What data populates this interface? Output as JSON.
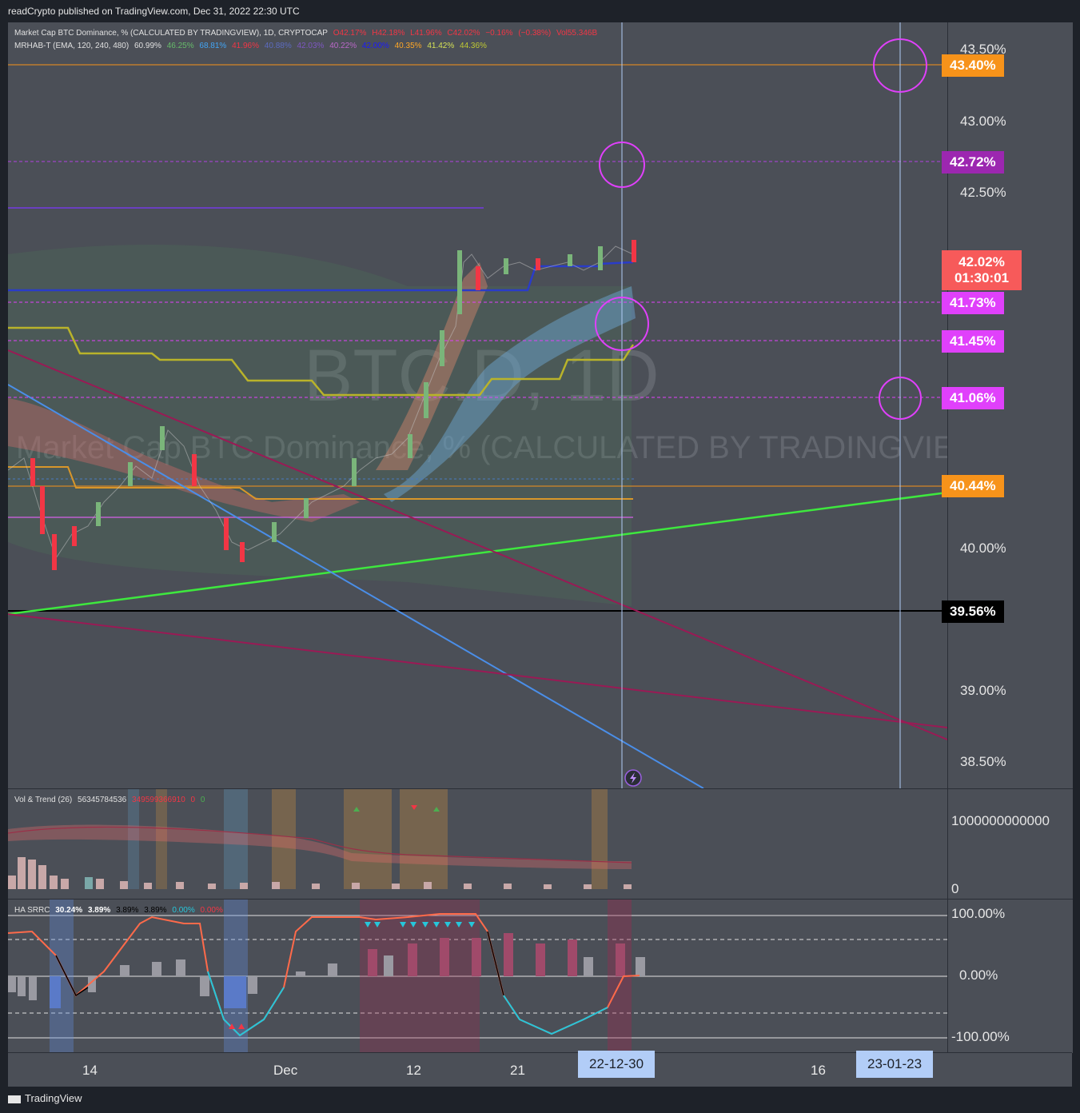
{
  "header": {
    "published": "readCrypto published on TradingView.com, Dec 31, 2022 22:30 UTC"
  },
  "legend_main": {
    "line1": [
      "Market Cap BTC Dominance, % (CALCULATED BY TRADINGVIEW), 1D, CRYPTOCAP",
      "O42.17%",
      "H42.18%",
      "L41.96%",
      "C42.02%",
      "−0.16%",
      "(−0.38%)",
      "Vol55.346B"
    ],
    "line2": [
      "MRHAB-T (EMA, 120, 240, 480)",
      "60.99%",
      "46.25%",
      "68.81%",
      "41.96%",
      "40.88%",
      "42.03%",
      "40.22%",
      "42.00%",
      "40.35%",
      "41.42%",
      "44.36%"
    ]
  },
  "watermark": {
    "symbol": "BTC.D, 1D",
    "name": "Market Cap BTC Dominance, % (CALCULATED BY TRADINGVIEW)"
  },
  "price_axis": {
    "ticks": [
      "43.50%",
      "43.00%",
      "42.50%",
      "40.00%",
      "39.00%",
      "38.50%"
    ]
  },
  "badges": {
    "b1": "43.40%",
    "b2": "42.72%",
    "b3": "42.02%",
    "b3_timer": "01:30:01",
    "b4": "41.73%",
    "b5": "41.45%",
    "b6": "41.06%",
    "b7": "40.44%",
    "b8": "39.56%"
  },
  "vol_pane": {
    "legend": [
      "Vol & Trend (26)",
      "56345784536",
      "349599366910",
      "0",
      "0"
    ],
    "ticks": [
      "1000000000000",
      "0"
    ]
  },
  "ha_pane": {
    "legend": [
      "HA SRRC",
      "30.24%",
      "3.89%",
      "3.89%",
      "3.89%",
      "0.00%",
      "0.00%"
    ],
    "ticks": [
      "100.00%",
      "0.00%",
      "-100.00%"
    ]
  },
  "time_axis": {
    "ticks": [
      "14",
      "Dec",
      "12",
      "21",
      "16"
    ],
    "selected": "22-12-30",
    "selected2": "23-01-23"
  },
  "footer": {
    "brand": "TradingView"
  },
  "colors": {
    "green": "#26a69a",
    "red": "#f23645",
    "magenta": "#e040fb",
    "orange": "#f7931a"
  }
}
